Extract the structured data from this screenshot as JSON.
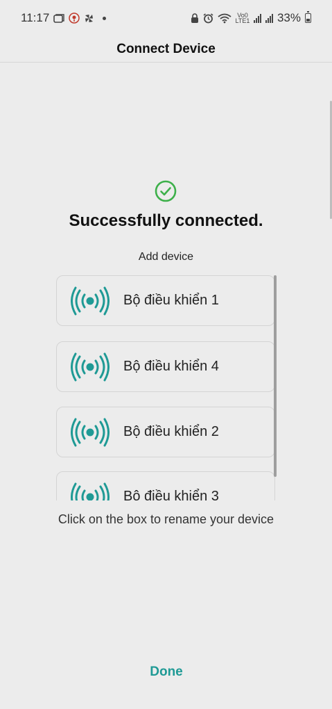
{
  "status_bar": {
    "time": "11:17",
    "battery": "33%",
    "icons_left": [
      "gallery-icon",
      "location-alert-icon",
      "pinwheel-icon",
      "notification-dot-icon"
    ],
    "icons_right": [
      "lock-icon",
      "alarm-icon",
      "wifi-icon",
      "volte-lte-icon",
      "signal-icon",
      "signal-icon",
      "battery-icon"
    ],
    "network_label": "Vo0 LTE1"
  },
  "header": {
    "title": "Connect Device"
  },
  "success": {
    "icon": "check-circle-icon",
    "title": "Successfully connected.",
    "add_device_label": "Add device"
  },
  "devices": [
    {
      "name": "Bộ điều khiển 1",
      "icon": "signal-broadcast-icon"
    },
    {
      "name": "Bộ điều khiển 4",
      "icon": "signal-broadcast-icon"
    },
    {
      "name": "Bộ điều khiển 2",
      "icon": "signal-broadcast-icon"
    },
    {
      "name": "Bộ điều khiển 3",
      "icon": "signal-broadcast-icon"
    }
  ],
  "hint": "Click on the box to rename your device",
  "footer": {
    "done_label": "Done"
  },
  "colors": {
    "accent": "#1f9a95",
    "success": "#3db04a",
    "background": "#ececec"
  }
}
